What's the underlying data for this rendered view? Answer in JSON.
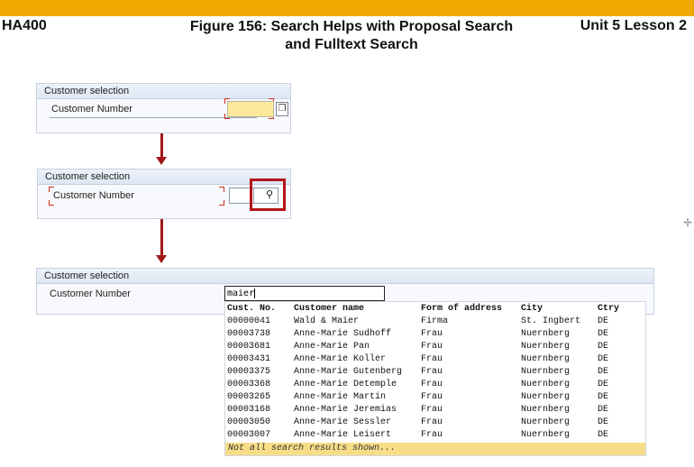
{
  "header": {
    "course": "HA400",
    "figure_title_line1": "Figure 156: Search Helps with Proposal Search",
    "figure_title_line2": "and Fulltext Search",
    "unit": "Unit 5 Lesson 2"
  },
  "colors": {
    "accent_bar": "#f0a800",
    "highlight_red": "#b5121b",
    "arrow": "#a01818",
    "input_yellow": "#fbe89a"
  },
  "step1": {
    "title": "Customer selection",
    "field_label": "Customer Number",
    "icon": "value-help-icon"
  },
  "step2": {
    "title": "Customer selection",
    "field_label": "Customer Number",
    "icon": "search-icon",
    "icon_glyph": "⚲"
  },
  "step3": {
    "title": "Customer selection",
    "field_label": "Customer Number",
    "search_value": "maier",
    "columns": [
      "Cust. No.",
      "Customer name",
      "Form of address",
      "City",
      "Ctry"
    ],
    "rows": [
      [
        "00000041",
        "Wald & Maier",
        "Firma",
        "St. Ingbert",
        "DE"
      ],
      [
        "00003738",
        "Anne-Marie Sudhoff",
        "Frau",
        "Nuernberg",
        "DE"
      ],
      [
        "00003681",
        "Anne-Marie Pan",
        "Frau",
        "Nuernberg",
        "DE"
      ],
      [
        "00003431",
        "Anne-Marie Koller",
        "Frau",
        "Nuernberg",
        "DE"
      ],
      [
        "00003375",
        "Anne-Marie Gutenberg",
        "Frau",
        "Nuernberg",
        "DE"
      ],
      [
        "00003368",
        "Anne-Marie Detemple",
        "Frau",
        "Nuernberg",
        "DE"
      ],
      [
        "00003265",
        "Anne-Marie Martin",
        "Frau",
        "Nuernberg",
        "DE"
      ],
      [
        "00003168",
        "Anne-Marie Jeremias",
        "Frau",
        "Nuernberg",
        "DE"
      ],
      [
        "00003050",
        "Anne-Marie Sessler",
        "Frau",
        "Nuernberg",
        "DE"
      ],
      [
        "00003007",
        "Anne-Marie Leisert",
        "Frau",
        "Nuernberg",
        "DE"
      ]
    ],
    "footer_note": "Not all search results shown..."
  }
}
